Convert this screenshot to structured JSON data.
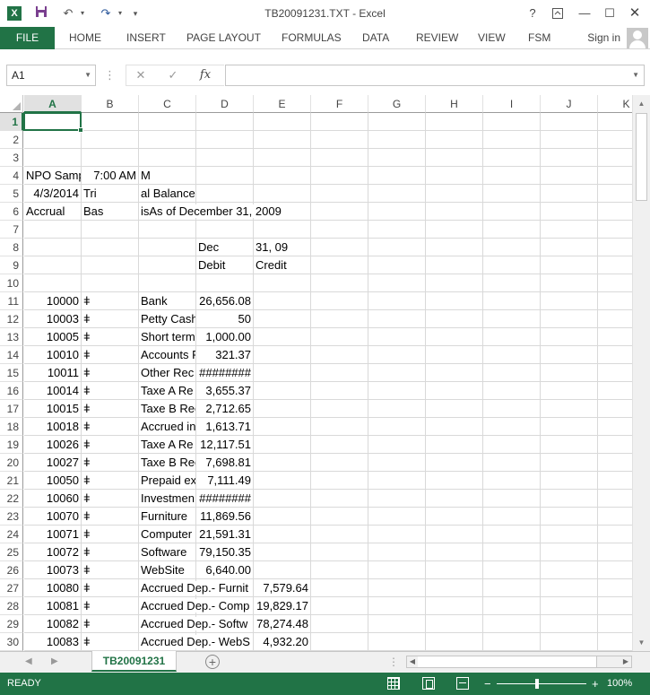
{
  "app": {
    "title": "TB20091231.TXT - Excel",
    "logo_letter": "X",
    "quick_access": [
      "save-icon",
      "undo-icon",
      "redo-icon",
      "customize-icon"
    ],
    "window_buttons": [
      "help-icon",
      "ribbon-display-icon",
      "minimize-icon",
      "maximize-icon",
      "close-icon"
    ]
  },
  "ribbon": {
    "file_tab": "FILE",
    "tabs": [
      "HOME",
      "INSERT",
      "PAGE LAYOUT",
      "FORMULAS",
      "DATA",
      "REVIEW",
      "VIEW",
      "FSM"
    ],
    "sign_in": "Sign in"
  },
  "formula_bar": {
    "name_box": "A1",
    "formula": "",
    "buttons": [
      "cancel-icon",
      "enter-icon",
      "insert-function-icon"
    ]
  },
  "grid": {
    "active_cell": "A1",
    "columns": [
      "A",
      "B",
      "C",
      "D",
      "E",
      "F",
      "G",
      "H",
      "I",
      "J",
      "K"
    ],
    "rows": [
      {
        "n": "1",
        "cells": {}
      },
      {
        "n": "2",
        "cells": {}
      },
      {
        "n": "3",
        "cells": {}
      },
      {
        "n": "4",
        "cells": {
          "A": "NPO Samp",
          "B": "7:00 AM",
          "C": "M"
        }
      },
      {
        "n": "5",
        "cells": {
          "A": "4/3/2014",
          "B": "Tri",
          "C": "al Balance"
        }
      },
      {
        "n": "6",
        "cells": {
          "A": "Accrual",
          "B": "Bas",
          "C": "isAs of December 31, 2009"
        }
      },
      {
        "n": "7",
        "cells": {}
      },
      {
        "n": "8",
        "cells": {
          "D": "Dec",
          "E": "31, 09"
        }
      },
      {
        "n": "9",
        "cells": {
          "D": "Debit",
          "E": "Credit"
        }
      },
      {
        "n": "10",
        "cells": {}
      },
      {
        "n": "11",
        "cells": {
          "A": "10000",
          "B": "ǂ",
          "C": "Bank",
          "D": "26,656.08"
        }
      },
      {
        "n": "12",
        "cells": {
          "A": "10003",
          "B": "ǂ",
          "C": "Petty Cash",
          "D": "50"
        }
      },
      {
        "n": "13",
        "cells": {
          "A": "10005",
          "B": "ǂ",
          "C": "Short term",
          "D": "1,000.00"
        }
      },
      {
        "n": "14",
        "cells": {
          "A": "10010",
          "B": "ǂ",
          "C": "Accounts R",
          "D": "321.37"
        }
      },
      {
        "n": "15",
        "cells": {
          "A": "10011",
          "B": "ǂ",
          "C": "Other Rec",
          "D": "########"
        }
      },
      {
        "n": "16",
        "cells": {
          "A": "10014",
          "B": "ǂ",
          "C": "Taxe A Re",
          "D": "3,655.37"
        }
      },
      {
        "n": "17",
        "cells": {
          "A": "10015",
          "B": "ǂ",
          "C": "Taxe B Rec",
          "D": "2,712.65"
        }
      },
      {
        "n": "18",
        "cells": {
          "A": "10018",
          "B": "ǂ",
          "C": "Accrued in",
          "D": "1,613.71"
        }
      },
      {
        "n": "19",
        "cells": {
          "A": "10026",
          "B": "ǂ",
          "C": "Taxe A Re",
          "D": "12,117.51"
        }
      },
      {
        "n": "20",
        "cells": {
          "A": "10027",
          "B": "ǂ",
          "C": "Taxe B Rec",
          "D": "7,698.81"
        }
      },
      {
        "n": "21",
        "cells": {
          "A": "10050",
          "B": "ǂ",
          "C": "Prepaid ex",
          "D": "7,111.49"
        }
      },
      {
        "n": "22",
        "cells": {
          "A": "10060",
          "B": "ǂ",
          "C": "Investmen",
          "D": "########"
        }
      },
      {
        "n": "23",
        "cells": {
          "A": "10070",
          "B": "ǂ",
          "C": "Furniture",
          "D": "11,869.56"
        }
      },
      {
        "n": "24",
        "cells": {
          "A": "10071",
          "B": "ǂ",
          "C": "Computer",
          "D": "21,591.31"
        }
      },
      {
        "n": "25",
        "cells": {
          "A": "10072",
          "B": "ǂ",
          "C": "Software",
          "D": "79,150.35"
        }
      },
      {
        "n": "26",
        "cells": {
          "A": "10073",
          "B": "ǂ",
          "C": "WebSite",
          "D": "6,640.00"
        }
      },
      {
        "n": "27",
        "cells": {
          "A": "10080",
          "B": "ǂ",
          "C": "Accrued Dep.- Furnit",
          "E": "7,579.64"
        }
      },
      {
        "n": "28",
        "cells": {
          "A": "10081",
          "B": "ǂ",
          "C": "Accrued Dep.- Comp",
          "E": "19,829.17"
        }
      },
      {
        "n": "29",
        "cells": {
          "A": "10082",
          "B": "ǂ",
          "C": "Accrued Dep.- Softw",
          "E": "78,274.48"
        }
      },
      {
        "n": "30",
        "cells": {
          "A": "10083",
          "B": "ǂ",
          "C": "Accrued Dep.- WebS",
          "E": "4,932.20"
        }
      }
    ]
  },
  "sheets": {
    "tabs": [
      "TB20091231"
    ],
    "active": "TB20091231",
    "add_label": "+"
  },
  "status": {
    "text": "READY",
    "zoom": "100%",
    "zoom_out": "−",
    "zoom_in": "+"
  },
  "colors": {
    "accent": "#217346",
    "gridline": "#d9d9d9",
    "header_selected": "#e1e1e1"
  }
}
